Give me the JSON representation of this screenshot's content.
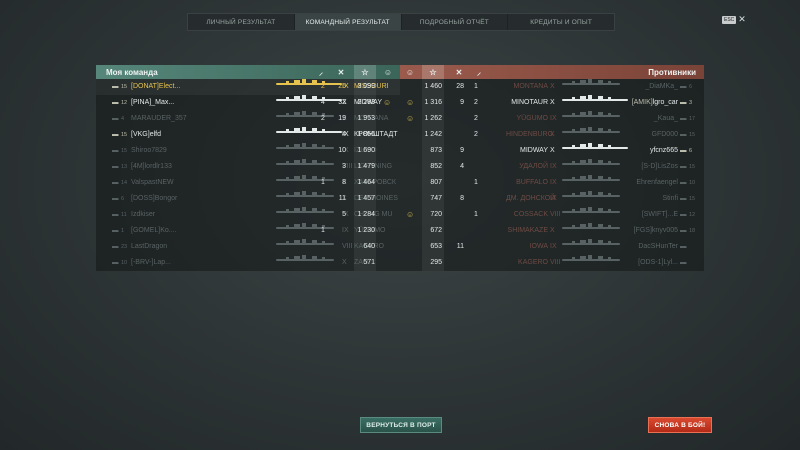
{
  "tabs": [
    {
      "label": "ЛИЧНЫЙ РЕЗУЛЬТАТ"
    },
    {
      "label": "КОМАНДНЫЙ РЕЗУЛЬТАТ"
    },
    {
      "label": "ПОДРОБНЫЙ ОТЧЁТ"
    },
    {
      "label": "КРЕДИТЫ И ОПЫТ"
    }
  ],
  "esc": {
    "key": "ESC",
    "close": "✕"
  },
  "my_team": {
    "title": "Моя команда",
    "rows": [
      {
        "rank": "15",
        "clan": "[DONAT]",
        "name": "Elect...",
        "tier": "IX",
        "ship": "MISSOURI",
        "kills": "2",
        "caps": "25",
        "xp": "3 099",
        "style": "gold",
        "hl": true
      },
      {
        "rank": "12",
        "clan": "[PINA]",
        "name": "_Max...",
        "tier": "X",
        "ship": "MIDWAY",
        "kills": "4",
        "caps": "32",
        "xp": "2 283",
        "style": "bright",
        "smile": true
      },
      {
        "rank": "4",
        "clan": "",
        "name": "MARAUDER_357",
        "tier": "X",
        "ship": "MONTANA",
        "kills": "2",
        "caps": "19",
        "xp": "1 953",
        "style": "dim"
      },
      {
        "rank": "15",
        "clan": "[VKG]",
        "name": "elfd",
        "tier": "IX",
        "ship": "КРОНШТАДТ",
        "kills": "",
        "caps": "4",
        "xp": "1 856",
        "style": "bright"
      },
      {
        "rank": "15",
        "clan": "",
        "name": "Shiroo7829",
        "tier": "IX",
        "ship": "IZUMO",
        "kills": "",
        "caps": "10",
        "xp": "1 690",
        "style": "dim"
      },
      {
        "rank": "13",
        "clan": "[4M]",
        "name": "lordlr133",
        "tier": "VIII",
        "ship": "LIGHTNING",
        "kills": "",
        "caps": "3",
        "xp": "1 479",
        "style": "dim"
      },
      {
        "rank": "14",
        "clan": "",
        "name": "ValspastNEW",
        "tier": "X",
        "ship": "ХАБАРОВСК",
        "kills": "1",
        "caps": "8",
        "xp": "1 464",
        "style": "dim"
      },
      {
        "rank": "6",
        "clan": "[DOSS]",
        "name": "Bongor",
        "tier": "X",
        "ship": "DES MOINES",
        "kills": "",
        "caps": "11",
        "xp": "1 457",
        "style": "dim"
      },
      {
        "rank": "11",
        "clan": "",
        "name": "Izdkiser",
        "tier": "IX",
        "ship": "CHUNG MU",
        "kills": "",
        "caps": "5",
        "xp": "1 284",
        "style": "dim"
      },
      {
        "rank": "1",
        "clan": "[GOMEL]",
        "name": "Ko....",
        "tier": "IX",
        "ship": "YŪGUMO",
        "kills": "1",
        "caps": "",
        "xp": "1 230",
        "style": "dim"
      },
      {
        "rank": "23",
        "clan": "",
        "name": "LastDragon",
        "tier": "VIII",
        "ship": "KAGERO",
        "kills": "",
        "caps": "",
        "xp": "640",
        "style": "dim"
      },
      {
        "rank": "10",
        "clan": "[-BRV-]",
        "name": "Lap...",
        "tier": "X",
        "ship": "ZAO",
        "kills": "",
        "caps": "",
        "xp": "571",
        "style": "dim"
      }
    ]
  },
  "enemy_team": {
    "title": "Противники",
    "rows": [
      {
        "xp": "1 460",
        "caps": "28",
        "kills": "1",
        "ship": "MONTANA",
        "tier": "X",
        "clan": "",
        "name": "_DiaMKa_",
        "rank": "6",
        "style": "dim"
      },
      {
        "xp": "1 316",
        "caps": "9",
        "kills": "2",
        "ship": "MINOTAUR",
        "tier": "X",
        "clan": "[AMIK]",
        "name": "lgro_car",
        "rank": "3",
        "style": "bright",
        "smile": true
      },
      {
        "xp": "1 262",
        "caps": "",
        "kills": "2",
        "ship": "YŪGUMO",
        "tier": "IX",
        "clan": "",
        "name": "_Kaua_",
        "rank": "17",
        "style": "dim",
        "smile": true
      },
      {
        "xp": "1 242",
        "caps": "",
        "kills": "2",
        "ship": "HINDENBURG",
        "tier": "X",
        "clan": "",
        "name": "GFD000",
        "rank": "15",
        "style": "dim"
      },
      {
        "xp": "873",
        "caps": "9",
        "kills": "",
        "ship": "MIDWAY",
        "tier": "X",
        "clan": "",
        "name": "yfcnz665",
        "rank": "6",
        "style": "bright"
      },
      {
        "xp": "852",
        "caps": "4",
        "kills": "",
        "ship": "УДАЛОЙ",
        "tier": "IX",
        "clan": "[S-D]",
        "name": "LisZos",
        "rank": "15",
        "style": "dim"
      },
      {
        "xp": "807",
        "caps": "",
        "kills": "1",
        "ship": "BUFFALO",
        "tier": "IX",
        "clan": "",
        "name": "Ehrenfaengel",
        "rank": "10",
        "style": "dim"
      },
      {
        "xp": "747",
        "caps": "8",
        "kills": "",
        "ship": "ДМ. ДОНСКОЙ",
        "tier": "IX",
        "clan": "",
        "name": "Stinfi",
        "rank": "15",
        "style": "dim"
      },
      {
        "xp": "720",
        "caps": "",
        "kills": "1",
        "ship": "COSSACK",
        "tier": "VIII",
        "clan": "[SWIFT]",
        "name": "...E",
        "rank": "12",
        "style": "dim",
        "smile": true
      },
      {
        "xp": "672",
        "caps": "",
        "kills": "",
        "ship": "SHIMAKAZE",
        "tier": "X",
        "clan": "[FGS]",
        "name": "knyv005",
        "rank": "18",
        "style": "dim"
      },
      {
        "xp": "653",
        "caps": "11",
        "kills": "",
        "ship": "IOWA",
        "tier": "IX",
        "clan": "",
        "name": "DacSHunTer",
        "rank": "",
        "style": "dim"
      },
      {
        "xp": "295",
        "caps": "",
        "kills": "",
        "ship": "KAGERO",
        "tier": "VIII",
        "clan": "[ODS-1]",
        "name": "Lyl...",
        "rank": "",
        "style": "dim"
      }
    ]
  },
  "buttons": {
    "port": "ВЕРНУТЬСЯ В ПОРТ",
    "battle": "СНОВА В БОЙ!"
  }
}
